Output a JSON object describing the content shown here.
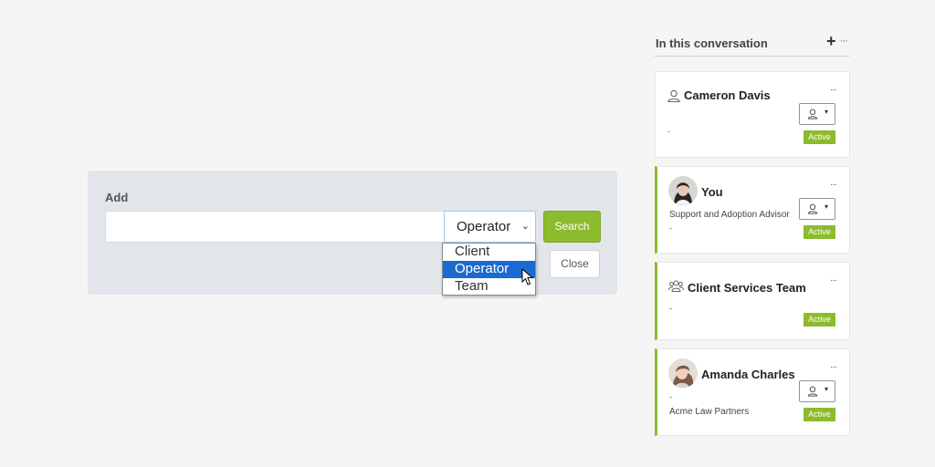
{
  "add_panel": {
    "label": "Add",
    "search_value": "",
    "type_select": {
      "selected": "Operator",
      "options": [
        "Client",
        "Operator",
        "Team"
      ],
      "highlighted": "Operator"
    },
    "search_label": "Search",
    "close_label": "Close"
  },
  "conversation": {
    "title": "In this conversation",
    "add_symbol": "+",
    "more_symbol": "···",
    "participants": [
      {
        "name": "Cameron Davis",
        "subtitle": "",
        "detail": "-",
        "status": "Active",
        "icon": "person-icon"
      },
      {
        "name": "You",
        "subtitle": "Support and Adoption Advisor",
        "detail": "-",
        "status": "Active",
        "icon": "avatar"
      },
      {
        "name": "Client Services Team",
        "subtitle": "",
        "detail": "-",
        "status": "Active",
        "icon": "team-icon"
      },
      {
        "name": "Amanda Charles",
        "subtitle": "-",
        "detail": "Acme Law Partners",
        "status": "Active",
        "icon": "avatar"
      }
    ]
  },
  "colors": {
    "accent": "#8dbb2e",
    "selection": "#1b6ad0",
    "panel": "#e2e6ea"
  }
}
